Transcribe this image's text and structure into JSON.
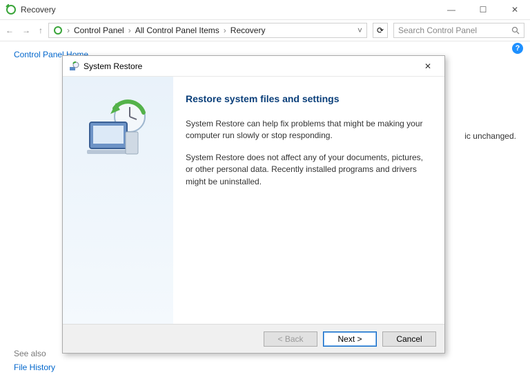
{
  "parent": {
    "title": "Recovery",
    "controls": {
      "min": "—",
      "max": "☐",
      "close": "✕"
    }
  },
  "nav": {
    "back": "←",
    "forward": "→",
    "up": "↑",
    "breadcrumb": {
      "seg1": "Control Panel",
      "seg2": "All Control Panel Items",
      "seg3": "Recovery"
    },
    "refresh": "⟳",
    "search_placeholder": "Search Control Panel"
  },
  "left": {
    "home": "Control Panel Home"
  },
  "bg_text": "ic unchanged.",
  "help": "?",
  "see_also": {
    "title": "See also",
    "item1": "File History"
  },
  "dialog": {
    "title": "System Restore",
    "close": "✕",
    "heading": "Restore system files and settings",
    "p1": "System Restore can help fix problems that might be making your computer run slowly or stop responding.",
    "p2": "System Restore does not affect any of your documents, pictures, or other personal data. Recently installed programs and drivers might be uninstalled.",
    "buttons": {
      "back": "< Back",
      "next": "Next >",
      "cancel": "Cancel"
    }
  }
}
